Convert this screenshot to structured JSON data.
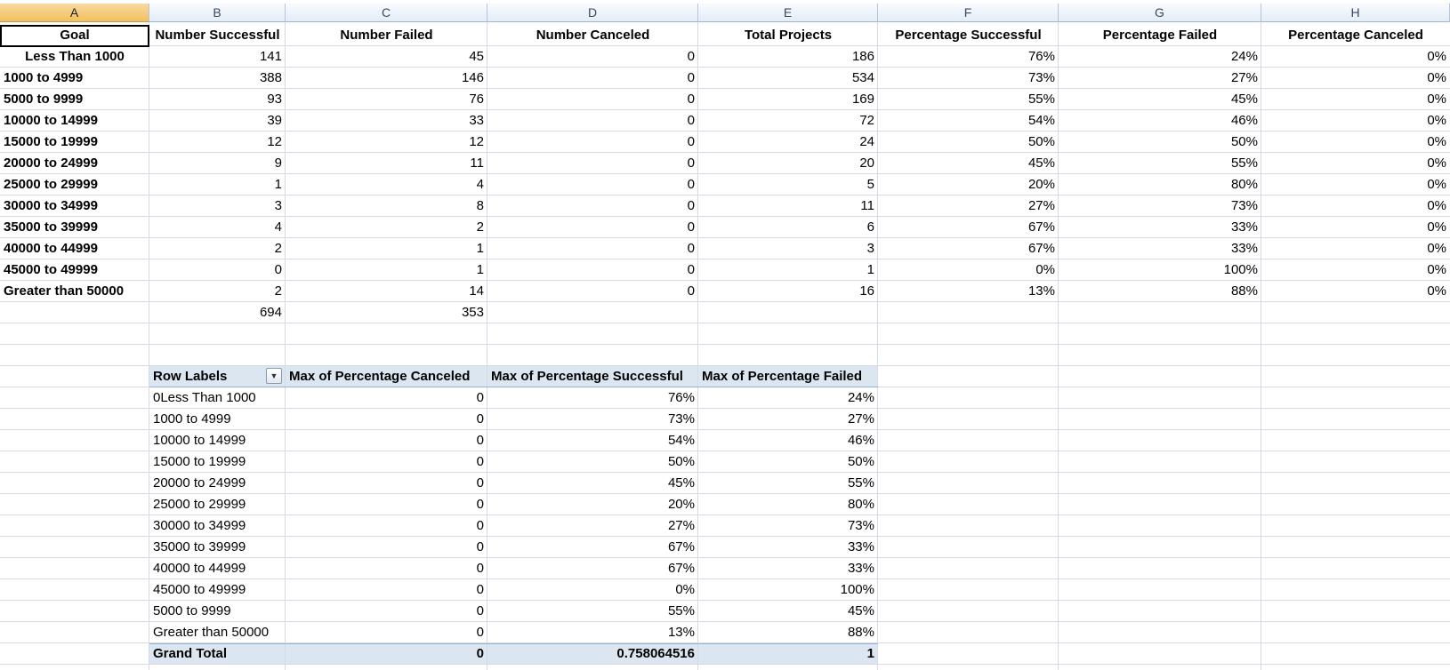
{
  "columns": [
    "A",
    "B",
    "C",
    "D",
    "E",
    "F",
    "G",
    "H"
  ],
  "headers": [
    "Goal",
    "Number Successful",
    "Number Failed",
    "Number Canceled",
    "Total Projects",
    "Percentage Successful",
    "Percentage Failed",
    "Percentage Canceled"
  ],
  "rows": [
    [
      "Less Than 1000",
      "141",
      "45",
      "0",
      "186",
      "76%",
      "24%",
      "0%"
    ],
    [
      "1000 to 4999",
      "388",
      "146",
      "0",
      "534",
      "73%",
      "27%",
      "0%"
    ],
    [
      "5000 to 9999",
      "93",
      "76",
      "0",
      "169",
      "55%",
      "45%",
      "0%"
    ],
    [
      "10000 to 14999",
      "39",
      "33",
      "0",
      "72",
      "54%",
      "46%",
      "0%"
    ],
    [
      "15000 to 19999",
      "12",
      "12",
      "0",
      "24",
      "50%",
      "50%",
      "0%"
    ],
    [
      "20000 to 24999",
      "9",
      "11",
      "0",
      "20",
      "45%",
      "55%",
      "0%"
    ],
    [
      "25000 to 29999",
      "1",
      "4",
      "0",
      "5",
      "20%",
      "80%",
      "0%"
    ],
    [
      "30000 to 34999",
      "3",
      "8",
      "0",
      "11",
      "27%",
      "73%",
      "0%"
    ],
    [
      "35000 to 39999",
      "4",
      "2",
      "0",
      "6",
      "67%",
      "33%",
      "0%"
    ],
    [
      "40000 to 44999",
      "2",
      "1",
      "0",
      "3",
      "67%",
      "33%",
      "0%"
    ],
    [
      "45000 to 49999",
      "0",
      "1",
      "0",
      "1",
      "0%",
      "100%",
      "0%"
    ],
    [
      "Greater than 50000",
      "2",
      "14",
      "0",
      "16",
      "13%",
      "88%",
      "0%"
    ]
  ],
  "totals": {
    "successful": "694",
    "failed": "353"
  },
  "pivot": {
    "headers": [
      "Row Labels",
      "Max of Percentage Canceled",
      "Max of Percentage Successful",
      "Max of Percentage Failed"
    ],
    "filter_icon": "dropdown-arrow-icon",
    "rows": [
      [
        "0Less Than 1000",
        "0",
        "76%",
        "24%"
      ],
      [
        "1000 to 4999",
        "0",
        "73%",
        "27%"
      ],
      [
        "10000 to 14999",
        "0",
        "54%",
        "46%"
      ],
      [
        "15000 to 19999",
        "0",
        "50%",
        "50%"
      ],
      [
        "20000 to 24999",
        "0",
        "45%",
        "55%"
      ],
      [
        "25000 to 29999",
        "0",
        "20%",
        "80%"
      ],
      [
        "30000 to 34999",
        "0",
        "27%",
        "73%"
      ],
      [
        "35000 to 39999",
        "0",
        "67%",
        "33%"
      ],
      [
        "40000 to 44999",
        "0",
        "67%",
        "33%"
      ],
      [
        "45000 to 49999",
        "0",
        "0%",
        "100%"
      ],
      [
        "5000 to 9999",
        "0",
        "55%",
        "45%"
      ],
      [
        "Greater than 50000",
        "0",
        "13%",
        "88%"
      ]
    ],
    "grand_total": [
      "Grand Total",
      "0",
      "0.758064516",
      "1"
    ]
  },
  "colors": {
    "pivot_header": "#dce6f1",
    "grid": "#d4dbe6",
    "selected_header": "#f1c15f"
  }
}
